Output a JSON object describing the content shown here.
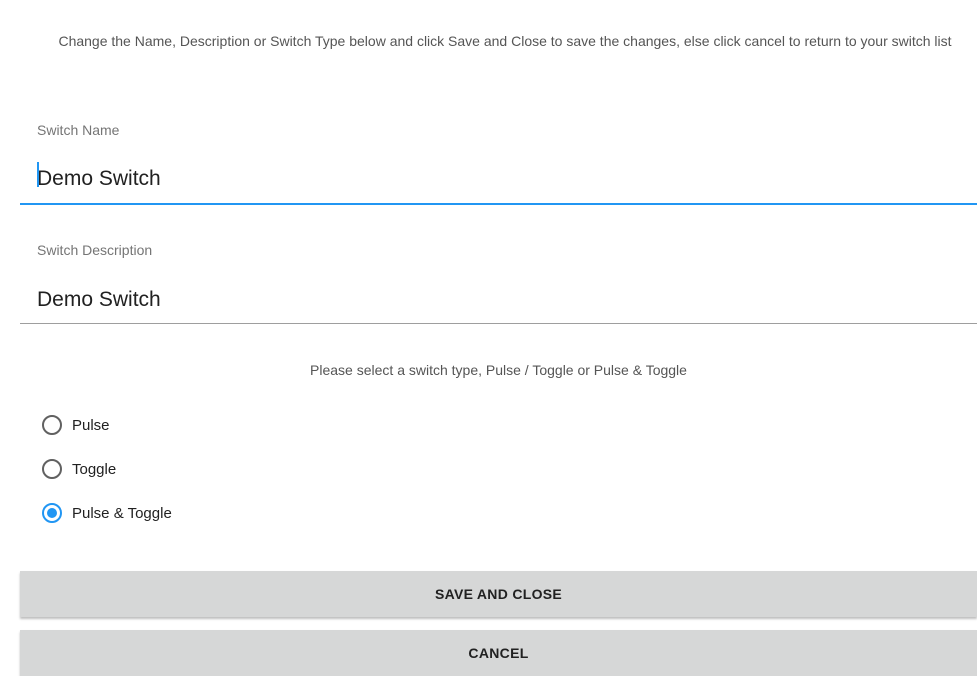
{
  "intro_text": "Change the Name, Description or Switch Type below and click Save and Close to save the changes, else click cancel to return to your switch list",
  "switch_name": {
    "label": "Switch Name",
    "value": "Demo Switch"
  },
  "switch_description": {
    "label": "Switch Description",
    "value": "Demo Switch"
  },
  "switch_type": {
    "prompt": "Please select a switch type, Pulse / Toggle or Pulse & Toggle",
    "options": [
      {
        "label": "Pulse",
        "checked": false
      },
      {
        "label": "Toggle",
        "checked": false
      },
      {
        "label": "Pulse & Toggle",
        "checked": true
      }
    ]
  },
  "buttons": {
    "save_label": "SAVE AND CLOSE",
    "cancel_label": "CANCEL"
  },
  "colors": {
    "accent": "#2196f3",
    "button_bg": "#d6d7d7"
  }
}
